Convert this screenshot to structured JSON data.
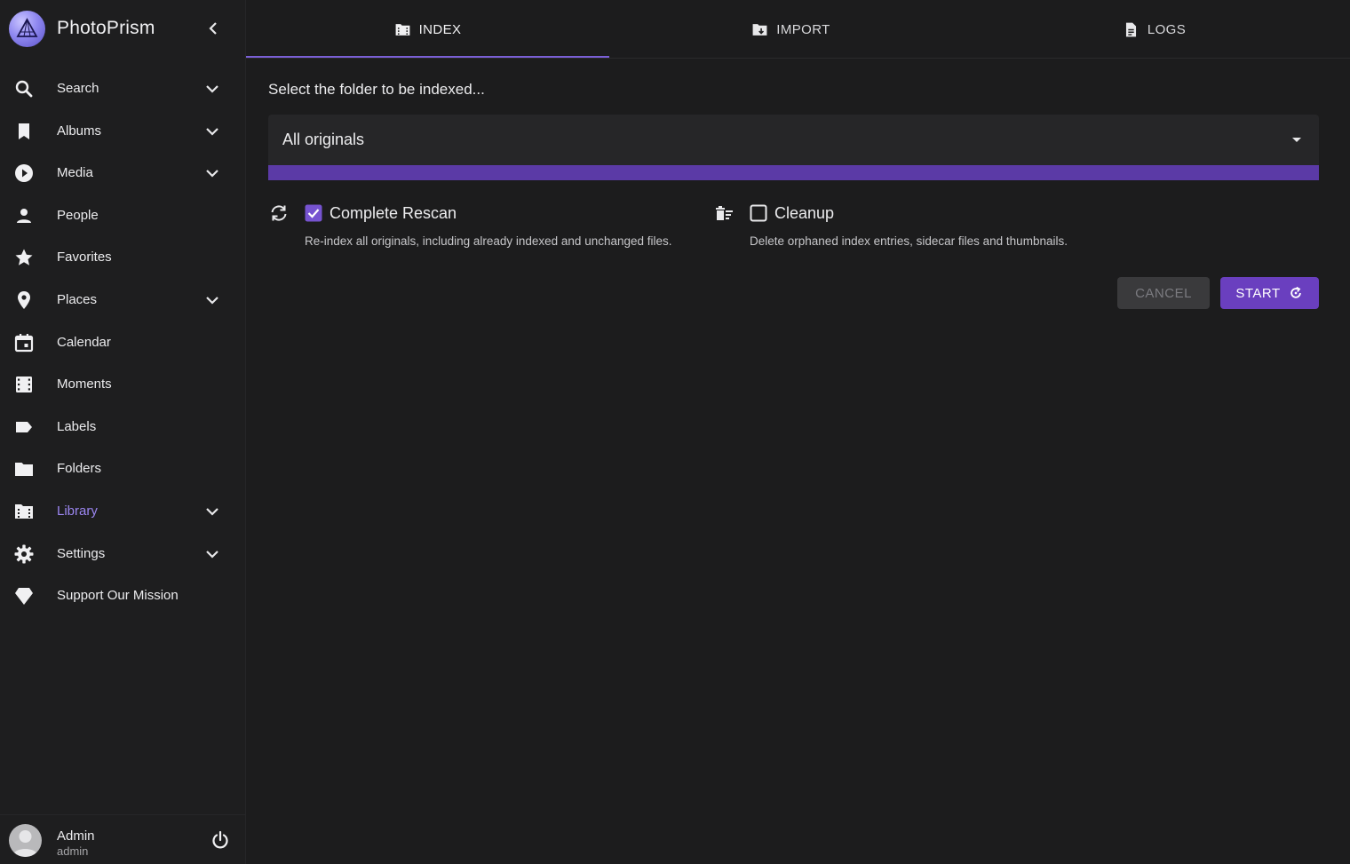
{
  "app": {
    "name": "PhotoPrism"
  },
  "sidebar": {
    "items": [
      {
        "label": "Search",
        "icon": "search-icon",
        "expandable": true
      },
      {
        "label": "Albums",
        "icon": "bookmark-icon",
        "expandable": true
      },
      {
        "label": "Media",
        "icon": "play-circle-icon",
        "expandable": true
      },
      {
        "label": "People",
        "icon": "person-icon",
        "expandable": false
      },
      {
        "label": "Favorites",
        "icon": "star-icon",
        "expandable": false
      },
      {
        "label": "Places",
        "icon": "map-pin-icon",
        "expandable": true
      },
      {
        "label": "Calendar",
        "icon": "calendar-icon",
        "expandable": false
      },
      {
        "label": "Moments",
        "icon": "film-icon",
        "expandable": false
      },
      {
        "label": "Labels",
        "icon": "label-icon",
        "expandable": false
      },
      {
        "label": "Folders",
        "icon": "folder-icon",
        "expandable": false
      },
      {
        "label": "Library",
        "icon": "library-icon",
        "expandable": true,
        "active": true
      },
      {
        "label": "Settings",
        "icon": "gear-icon",
        "expandable": true
      },
      {
        "label": "Support Our Mission",
        "icon": "diamond-icon",
        "expandable": false
      }
    ],
    "user": {
      "name": "Admin",
      "login": "admin"
    }
  },
  "tabs": [
    {
      "label": "INDEX",
      "icon": "library-icon",
      "active": true
    },
    {
      "label": "IMPORT",
      "icon": "folder-import-icon",
      "active": false
    },
    {
      "label": "LOGS",
      "icon": "file-icon",
      "active": false
    }
  ],
  "index": {
    "prompt": "Select the folder to be indexed...",
    "folder_select": {
      "value": "All originals"
    },
    "progress_percent": 100,
    "options": {
      "rescan": {
        "label": "Complete Rescan",
        "hint": "Re-index all originals, including already indexed and unchanged files.",
        "checked": true
      },
      "cleanup": {
        "label": "Cleanup",
        "hint": "Delete orphaned index entries, sidecar files and thumbnails.",
        "checked": false
      }
    },
    "buttons": {
      "cancel": "CANCEL",
      "start": "START"
    }
  },
  "colors": {
    "accent": "#6a3fbf",
    "active_nav_text": "#9b86f0",
    "progress": "#4a2f88",
    "background": "#1c1c1d",
    "sidebar_bg": "#1e1e1f"
  }
}
